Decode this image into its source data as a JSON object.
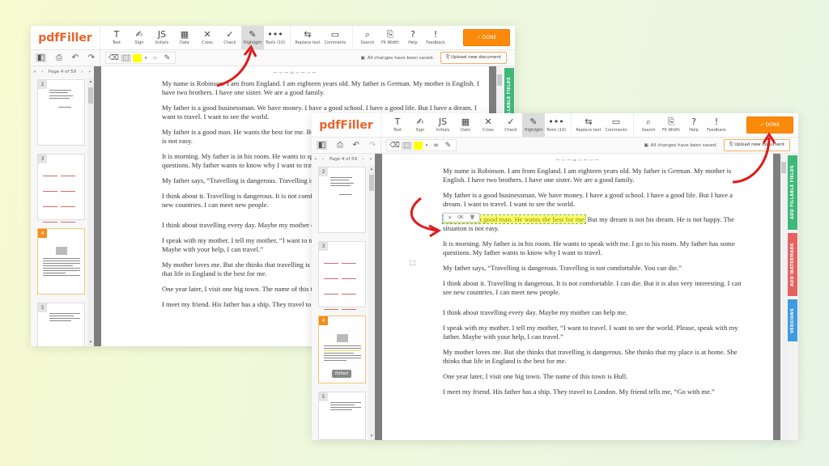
{
  "app": {
    "logo": "pdfFiller",
    "tools": [
      {
        "icon": "text-icon",
        "glyph": "T",
        "label": "Text"
      },
      {
        "icon": "sign-icon",
        "glyph": "✍",
        "label": "Sign"
      },
      {
        "icon": "initials-icon",
        "glyph": "JS",
        "label": "Initials"
      },
      {
        "icon": "date-icon",
        "glyph": "▦",
        "label": "Date"
      },
      {
        "icon": "cross-icon",
        "glyph": "✕",
        "label": "Cross"
      },
      {
        "icon": "check-icon",
        "glyph": "✓",
        "label": "Check"
      },
      {
        "icon": "highlight-icon",
        "glyph": "✎",
        "label": "Highlight",
        "active": true
      },
      {
        "icon": "more-tools-icon",
        "glyph": "•••",
        "label": "Tools (10)"
      }
    ],
    "tools2": [
      {
        "icon": "replace-text-icon",
        "glyph": "⇆",
        "label": "Replace text"
      },
      {
        "icon": "comments-icon",
        "glyph": "▭",
        "label": "Comments"
      }
    ],
    "tools3": [
      {
        "icon": "search-icon",
        "glyph": "⌕",
        "label": "Search"
      },
      {
        "icon": "fit-width-icon",
        "glyph": "⎘",
        "label": "Fit Width"
      },
      {
        "icon": "help-icon",
        "glyph": "?",
        "label": "Help"
      },
      {
        "icon": "feedback-icon",
        "glyph": "!",
        "label": "Feedback"
      }
    ],
    "done_label": "✓ DONE",
    "saved_status": "All changes have been saved.",
    "upload_label": "Upload new document",
    "pager": {
      "first": "«",
      "prev": "‹",
      "label": "Page 4 of 59",
      "next": "›",
      "last": "»"
    },
    "thumbnails": [
      {
        "num": "2"
      },
      {
        "num": "3"
      },
      {
        "num": "4",
        "current": true,
        "badge": "Edited"
      },
      {
        "num": "5"
      }
    ],
    "side_tabs": {
      "fillable": "ADD FILLABLE FIELDS",
      "watermark": "ADD WATERMARK",
      "versions": "VERSIONS"
    },
    "mini_toolbar": {
      "move": "⇲",
      "ok": "OK",
      "delete": "🗑"
    },
    "colors": {
      "brand": "#e8632b",
      "done": "#fb8a0b",
      "highlight": "#ffff00",
      "tab_green": "#3fb979",
      "tab_red": "#e66262",
      "tab_blue": "#3f9be0",
      "annotation_arrow": "#e01b1b"
    }
  },
  "document": {
    "paragraphs": [
      "My name is Robinson. I am from England. I am eighteen years old. My father is German. My mother is English. I have two brothers. I have one sister. We are a good family.",
      "My father is a good businessman. We have money. I have a good school. I have a good life. But I have a dream. I want to travel. I want to see the world.",
      "My father is a good man. He wants the best for me. But my dream is not his dream. He is not happy. The situation is not easy.",
      "It is morning. My father is in his room. He wants to speak with me. I go to his room. My father has some questions. My father wants to know why I want to travel.",
      "My father says, “Travelling is dangerous. Travelling is not comfortable. You can die.”",
      "I think about it. Travelling is dangerous. It is not comfortable. I can die. But it is also very interesting. I can see new countries. I can meet new people.",
      "I think about travelling every day. Maybe my mother can help me.",
      "I speak with my mother. I tell my mother, “I want to travel. I want to see the world. Please, speak with my father. Maybe with your help, I can travel.”",
      "My mother loves me. But she thinks that travelling is dangerous. She thinks that my place is at home. She thinks that life in England is the best for me.",
      "One year later, I visit one big town. The name of this town is Hull.",
      "I meet my friend. His father has a ship. They travel to London. My friend tells me, “Go with me.”"
    ],
    "highlighted": "My father is a good man. He wants the best for me.",
    "after_highlight": " But my dream is not his dream. He is not happy. The situation is not easy."
  }
}
